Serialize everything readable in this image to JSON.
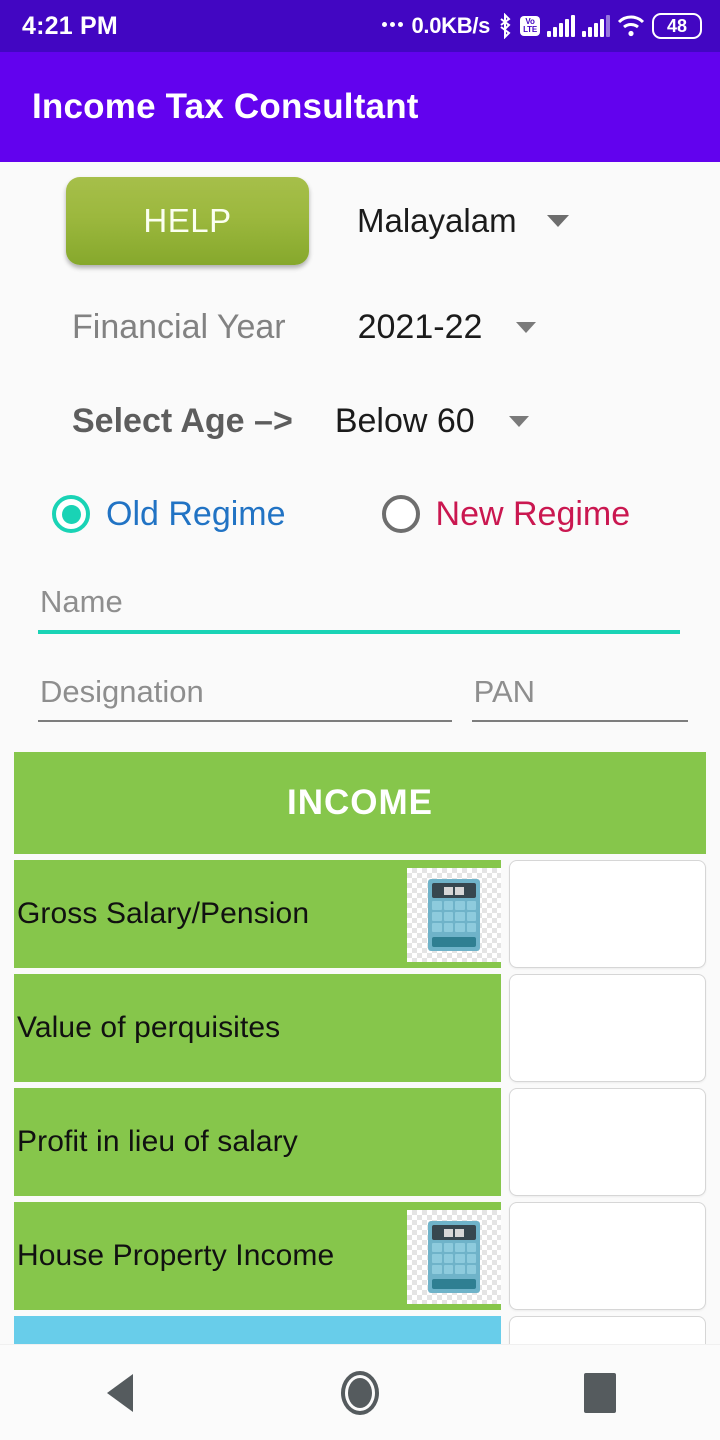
{
  "status_bar": {
    "time": "4:21 PM",
    "network_speed": "0.0KB/s",
    "volte_top": "Vo",
    "volte_bottom": "LTE",
    "battery_level": "48",
    "icons": [
      "bluetooth-icon",
      "volte-icon",
      "signal-icon",
      "signal-icon",
      "wifi-icon",
      "battery-icon"
    ]
  },
  "app_bar": {
    "title": "Income Tax Consultant",
    "background": "#6202ee"
  },
  "controls": {
    "help_label": "HELP",
    "language_value": "Malayalam",
    "financial_year_label": "Financial Year",
    "financial_year_value": "2021-22",
    "age_label": "Select Age –>",
    "age_value": "Below 60"
  },
  "regime": {
    "old_label": "Old Regime",
    "old_selected": true,
    "old_color": "#2173c4",
    "new_label": "New Regime",
    "new_selected": false,
    "new_color": "#ca1750",
    "accent": "#19d3b5"
  },
  "fields": {
    "name_placeholder": "Name",
    "name_value": "",
    "designation_placeholder": "Designation",
    "designation_value": "",
    "pan_placeholder": "PAN",
    "pan_value": ""
  },
  "income_table": {
    "header": "INCOME",
    "header_color": "#86c64b",
    "row_color": "#86c64b",
    "partial_row_color": "#68cdea",
    "rows": [
      {
        "label": "Gross Salary/Pension",
        "value": "",
        "has_calculator": true
      },
      {
        "label": "Value of perquisites",
        "value": "",
        "has_calculator": false
      },
      {
        "label": "Profit in lieu of salary",
        "value": "",
        "has_calculator": false
      },
      {
        "label": "House Property Income",
        "value": "",
        "has_calculator": true
      }
    ]
  },
  "nav_bar": {
    "back": "back-button",
    "home": "home-button",
    "recents": "recents-button"
  }
}
